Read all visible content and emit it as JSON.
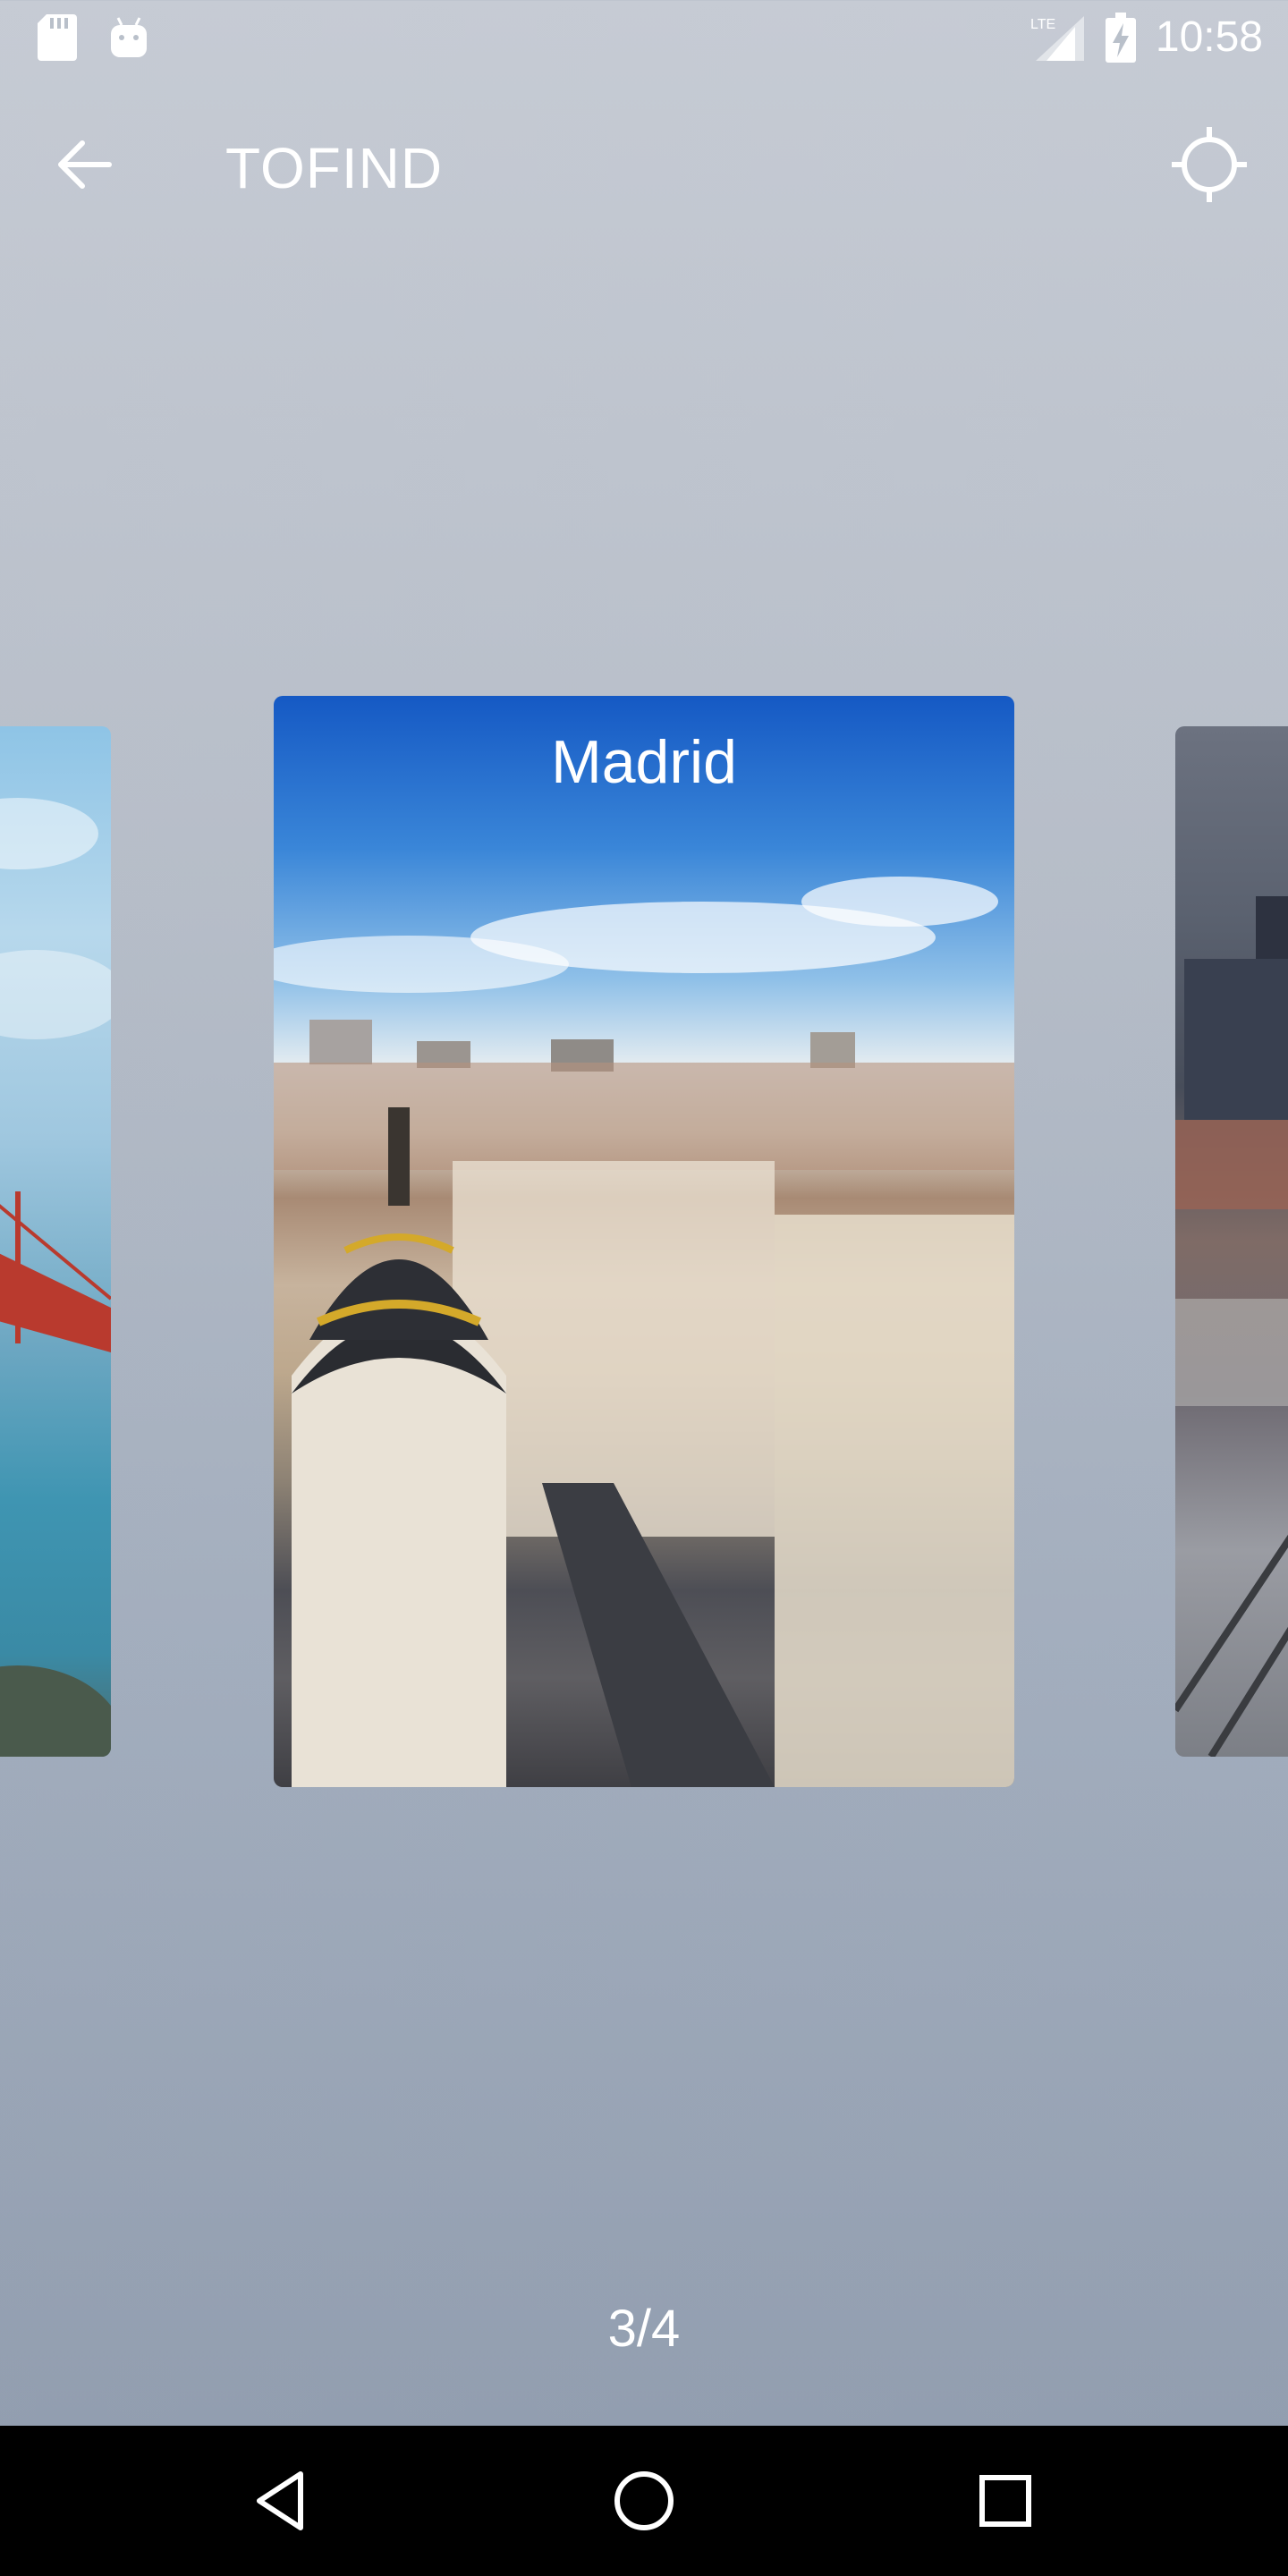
{
  "status_bar": {
    "time": "10:58",
    "network": "LTE",
    "icons": [
      "sd-card-icon",
      "android-icon",
      "signal-icon",
      "battery-charging-icon"
    ]
  },
  "app_bar": {
    "title": "TOFIND",
    "back_icon": "arrow-back-icon",
    "action_icon": "my-location-icon"
  },
  "carousel": {
    "current_card": {
      "title": "Madrid"
    },
    "counter": "3/4"
  },
  "nav_bar": {
    "icons": [
      "back-triangle-icon",
      "home-circle-icon",
      "recents-square-icon"
    ]
  },
  "colors": {
    "app_bar_text": "#ffffff",
    "background_top": "#c6cbd4",
    "background_bottom": "#8f9bad",
    "nav_bar": "#000000"
  }
}
